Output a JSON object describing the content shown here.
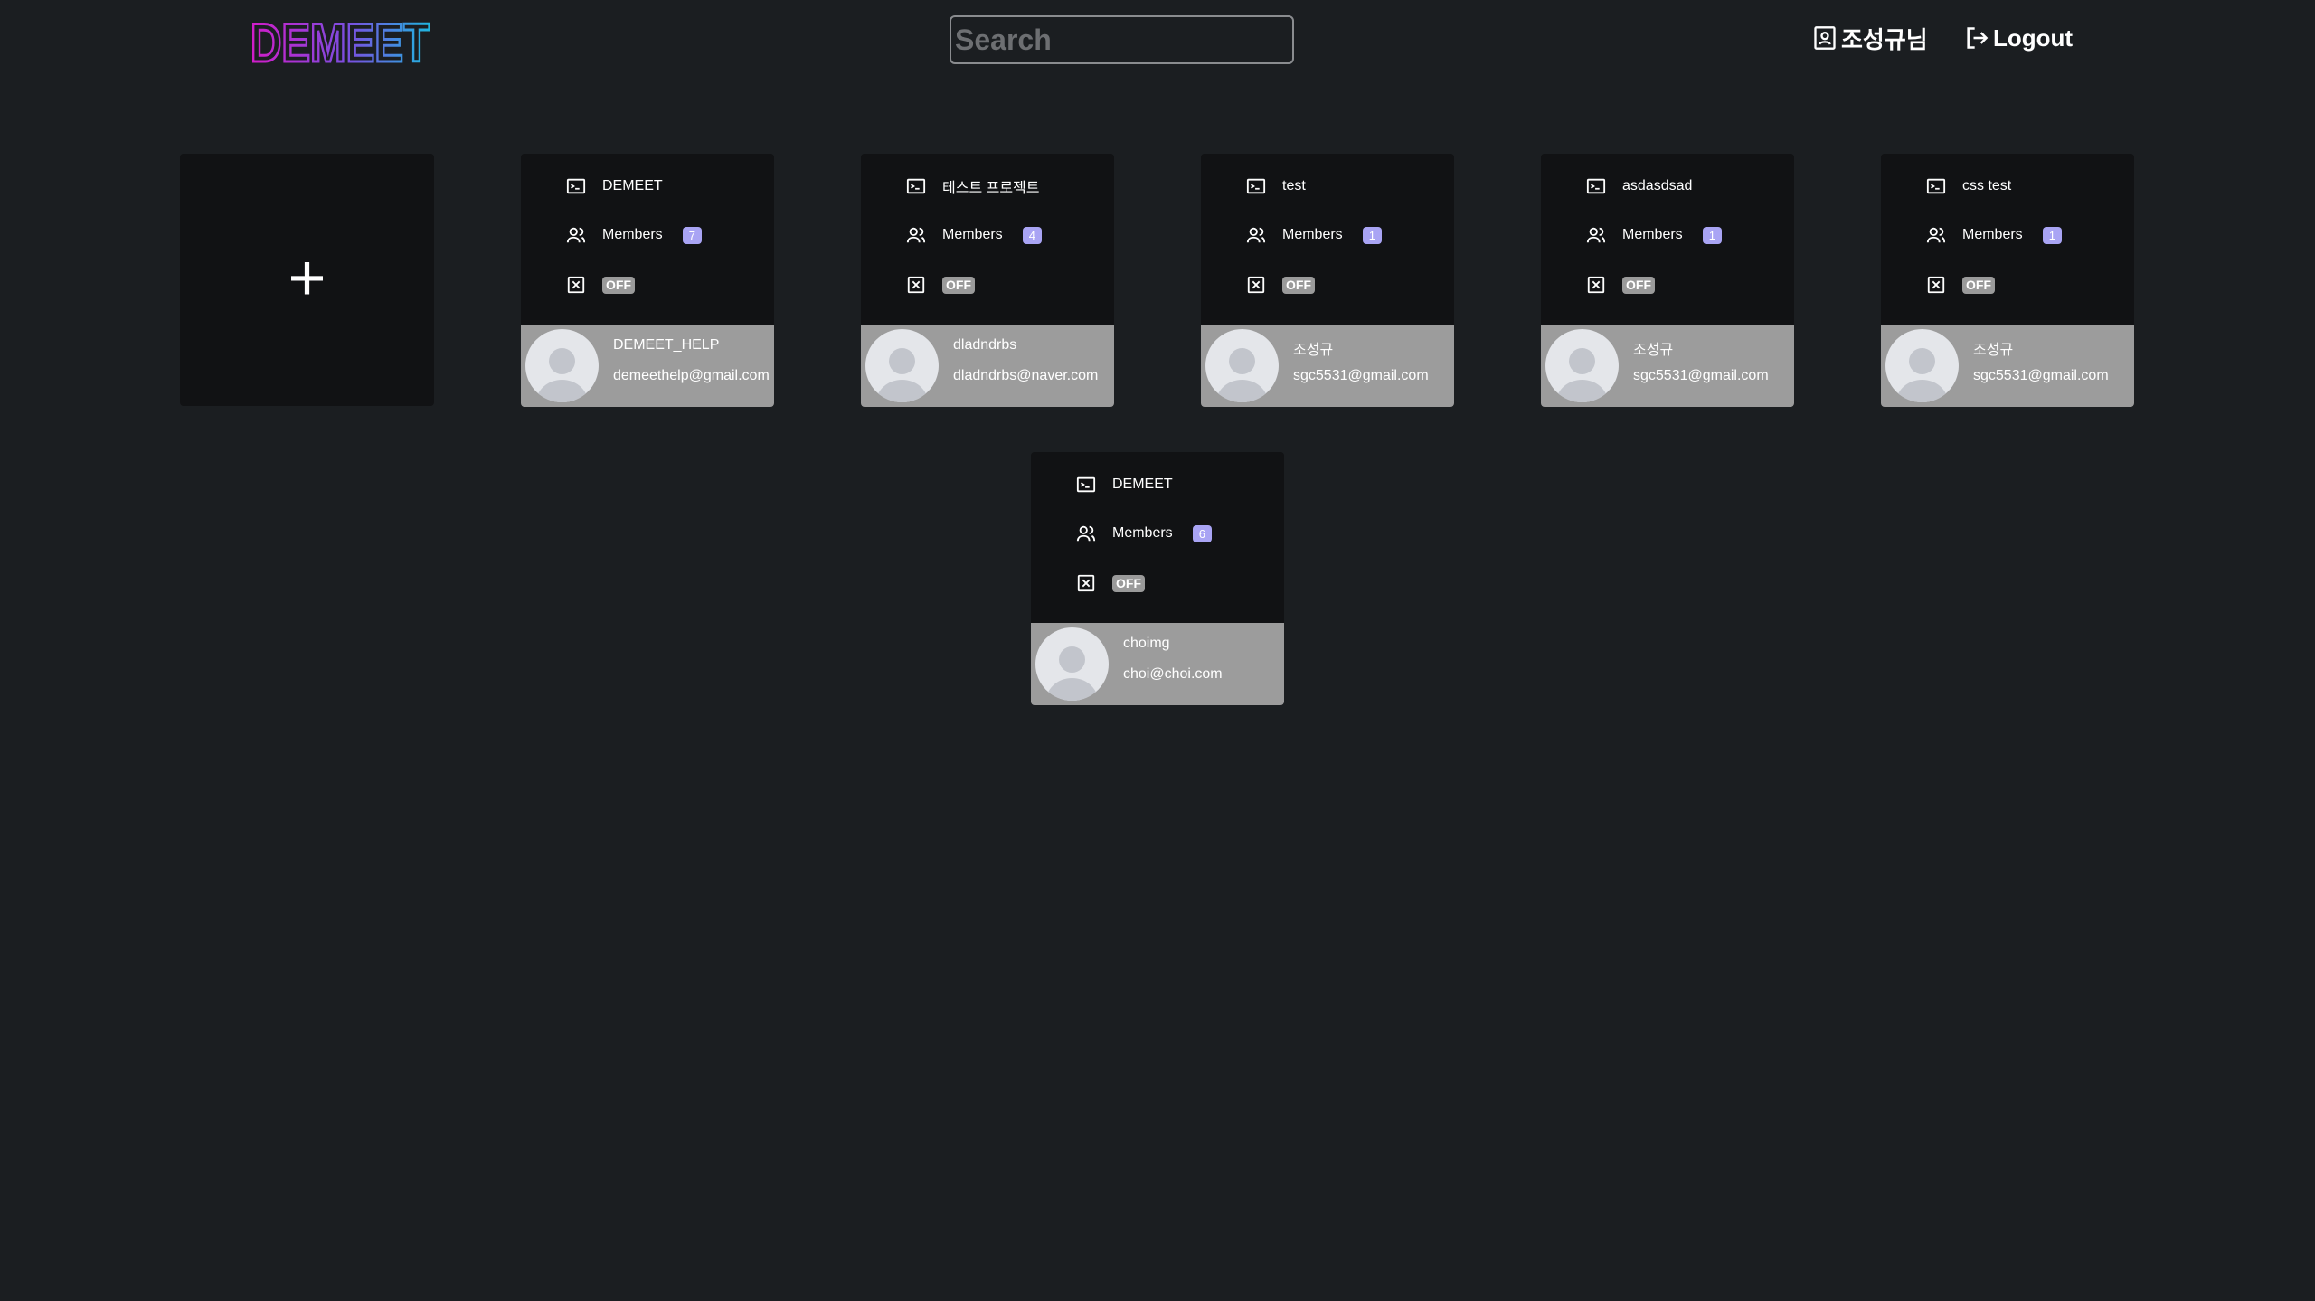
{
  "header": {
    "logo_text": "DEMEET",
    "search_placeholder": "Search",
    "user_label": "조성규님",
    "logout_label": "Logout"
  },
  "add_card": {
    "label": "+"
  },
  "projects": [
    {
      "title": "DEMEET",
      "members_label": "Members",
      "member_count": "7",
      "status": "OFF",
      "owner_name": "DEMEET_HELP",
      "owner_email": "demeethelp@gmail.com"
    },
    {
      "title": "테스트 프로젝트",
      "members_label": "Members",
      "member_count": "4",
      "status": "OFF",
      "owner_name": "dladndrbs",
      "owner_email": "dladndrbs@naver.com"
    },
    {
      "title": "test",
      "members_label": "Members",
      "member_count": "1",
      "status": "OFF",
      "owner_name": "조성규",
      "owner_email": "sgc5531@gmail.com"
    },
    {
      "title": "asdasdsad",
      "members_label": "Members",
      "member_count": "1",
      "status": "OFF",
      "owner_name": "조성규",
      "owner_email": "sgc5531@gmail.com"
    },
    {
      "title": "css test",
      "members_label": "Members",
      "member_count": "1",
      "status": "OFF",
      "owner_name": "조성규",
      "owner_email": "sgc5531@gmail.com"
    },
    {
      "title": "DEMEET",
      "members_label": "Members",
      "member_count": "6",
      "status": "OFF",
      "owner_name": "choimg",
      "owner_email": "choi@choi.com"
    }
  ],
  "colors": {
    "background": "#1b1e21",
    "card": "#111214",
    "owner_panel": "#9c9c9c",
    "badge": "#a9a4f4",
    "logo_gradient_start": "#d21cc8",
    "logo_gradient_end": "#1fb6e0"
  }
}
